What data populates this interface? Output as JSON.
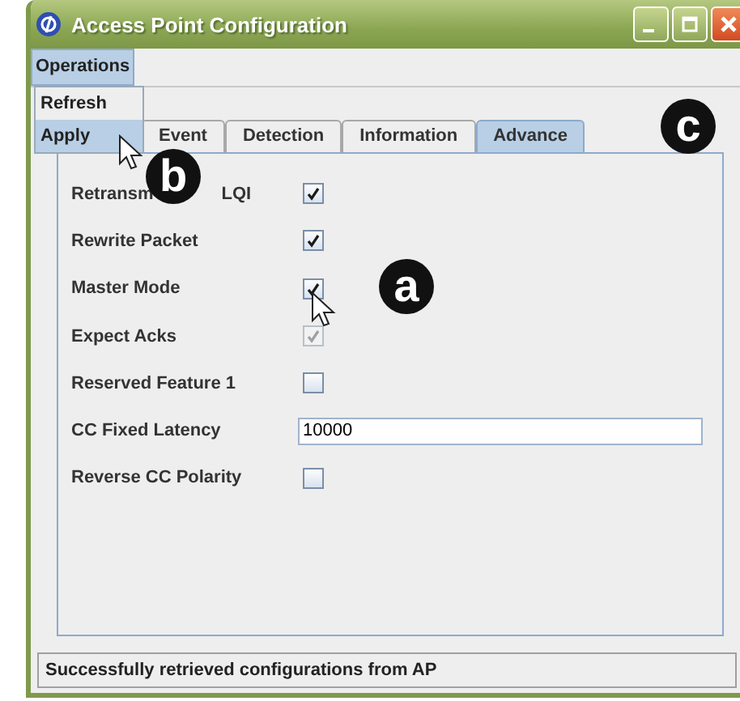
{
  "window": {
    "title": "Access Point Configuration"
  },
  "menu": [
    {
      "label": "Operations",
      "selected": true
    }
  ],
  "dropdown": [
    {
      "label": "Refresh",
      "selected": false
    },
    {
      "label": "Apply",
      "selected": true
    }
  ],
  "tabs": [
    {
      "label": "Event",
      "selected": false
    },
    {
      "label": "Detection",
      "selected": false
    },
    {
      "label": "Information",
      "selected": false
    },
    {
      "label": "Advance",
      "selected": true
    }
  ],
  "settings": [
    {
      "kind": "checkbox",
      "label_parts": [
        "Retransm",
        "LQI"
      ],
      "checked": true,
      "disabled": false
    },
    {
      "kind": "checkbox",
      "label": "Rewrite Packet",
      "checked": true,
      "disabled": false
    },
    {
      "kind": "checkbox",
      "label": "Master Mode",
      "checked": true,
      "disabled": false
    },
    {
      "kind": "checkbox",
      "label": "Expect Acks",
      "checked": true,
      "disabled": true
    },
    {
      "kind": "checkbox",
      "label": "Reserved Feature 1",
      "checked": false,
      "disabled": false
    },
    {
      "kind": "text",
      "label": "CC Fixed Latency",
      "value": "10000"
    },
    {
      "kind": "checkbox",
      "label": "Reverse CC Polarity",
      "checked": false,
      "disabled": false
    }
  ],
  "status_bar": "Successfully retrieved configurations from AP",
  "callouts": [
    "a",
    "b",
    "c"
  ]
}
